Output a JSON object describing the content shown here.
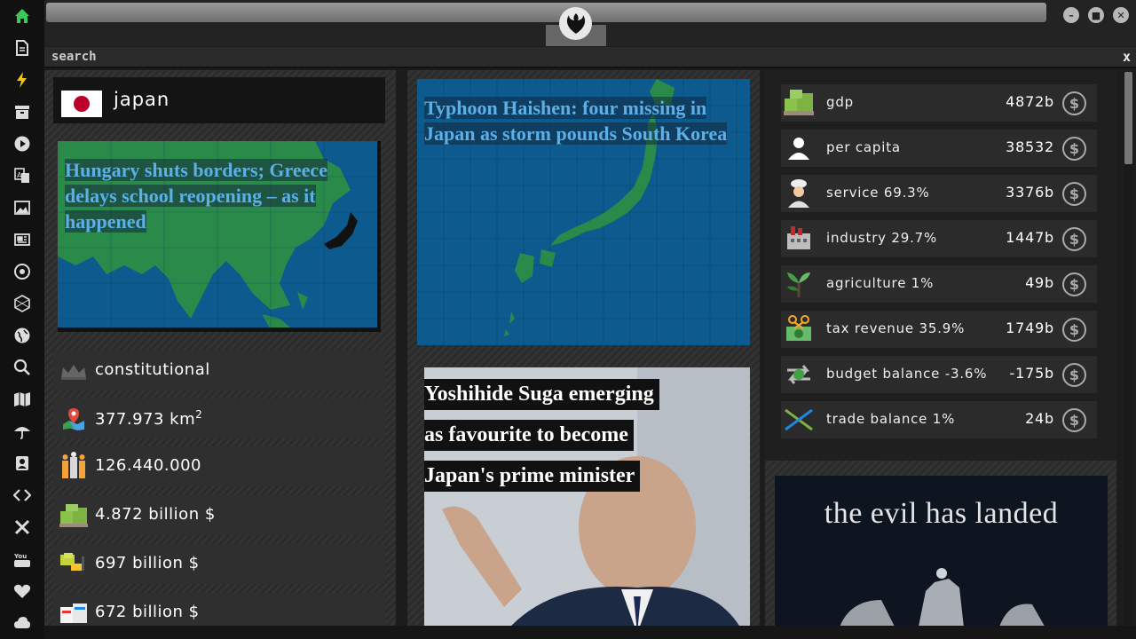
{
  "rail": {
    "icons": [
      "home-icon",
      "document-icon",
      "lightning-icon",
      "archive-icon",
      "play-icon",
      "translate-icon",
      "image-icon",
      "newspaper-icon",
      "settings-icon",
      "hexagon-icon",
      "globe-icon",
      "search-icon",
      "map-icon",
      "umbrella-icon",
      "contact-icon",
      "code-icon",
      "tools-icon",
      "youtube-icon",
      "heart-icon",
      "cloud-icon"
    ]
  },
  "search": {
    "label": "search",
    "close": "x"
  },
  "window": {
    "minimize": "–",
    "maximize": "■",
    "close": "✕"
  },
  "country": {
    "name": "japan"
  },
  "news": {
    "left_headline": "Hungary shuts borders; Greece delays school reopening – as it happened",
    "mid_headline": "Typhoon Haishen: four missing in Japan as storm pounds South Korea",
    "suga_lines": [
      " Yoshihide Suga emerging",
      "as favourite to become",
      "Japan's prime minister"
    ]
  },
  "stats": [
    {
      "icon": "crown-icon",
      "text": "constitutional"
    },
    {
      "icon": "area-map-icon",
      "text": "377.973 km",
      "sup": "2"
    },
    {
      "icon": "population-icon",
      "text": "126.440.000"
    },
    {
      "icon": "money-pallet-icon",
      "text": "4.872 billion $"
    },
    {
      "icon": "forklift-money-icon",
      "text": "697 billion $"
    },
    {
      "icon": "cargo-boxes-icon",
      "text": "672 billion $"
    }
  ],
  "economy": [
    {
      "icon": "gdp-icon",
      "label": "gdp",
      "value": "4872b"
    },
    {
      "icon": "person-icon",
      "label": "per capita",
      "value": "38532"
    },
    {
      "icon": "chef-icon",
      "label": "service 69.3%",
      "value": "3376b"
    },
    {
      "icon": "factory-icon",
      "label": "industry 29.7%",
      "value": "1447b"
    },
    {
      "icon": "plant-icon",
      "label": "agriculture 1%",
      "value": "49b"
    },
    {
      "icon": "tax-icon",
      "label": "tax revenue 35.9%",
      "value": "1749b"
    },
    {
      "icon": "budget-icon",
      "label": "budget balance -3.6%",
      "value": "-175b"
    },
    {
      "icon": "trade-icon",
      "label": "trade balance 1%",
      "value": "24b"
    }
  ],
  "dollar_symbol": "$",
  "promo": {
    "text": "the evil has landed"
  },
  "colors": {
    "accent_green": "#3fa35a",
    "map_blue": "#0d5a8e",
    "map_green": "#2a8a4a"
  }
}
